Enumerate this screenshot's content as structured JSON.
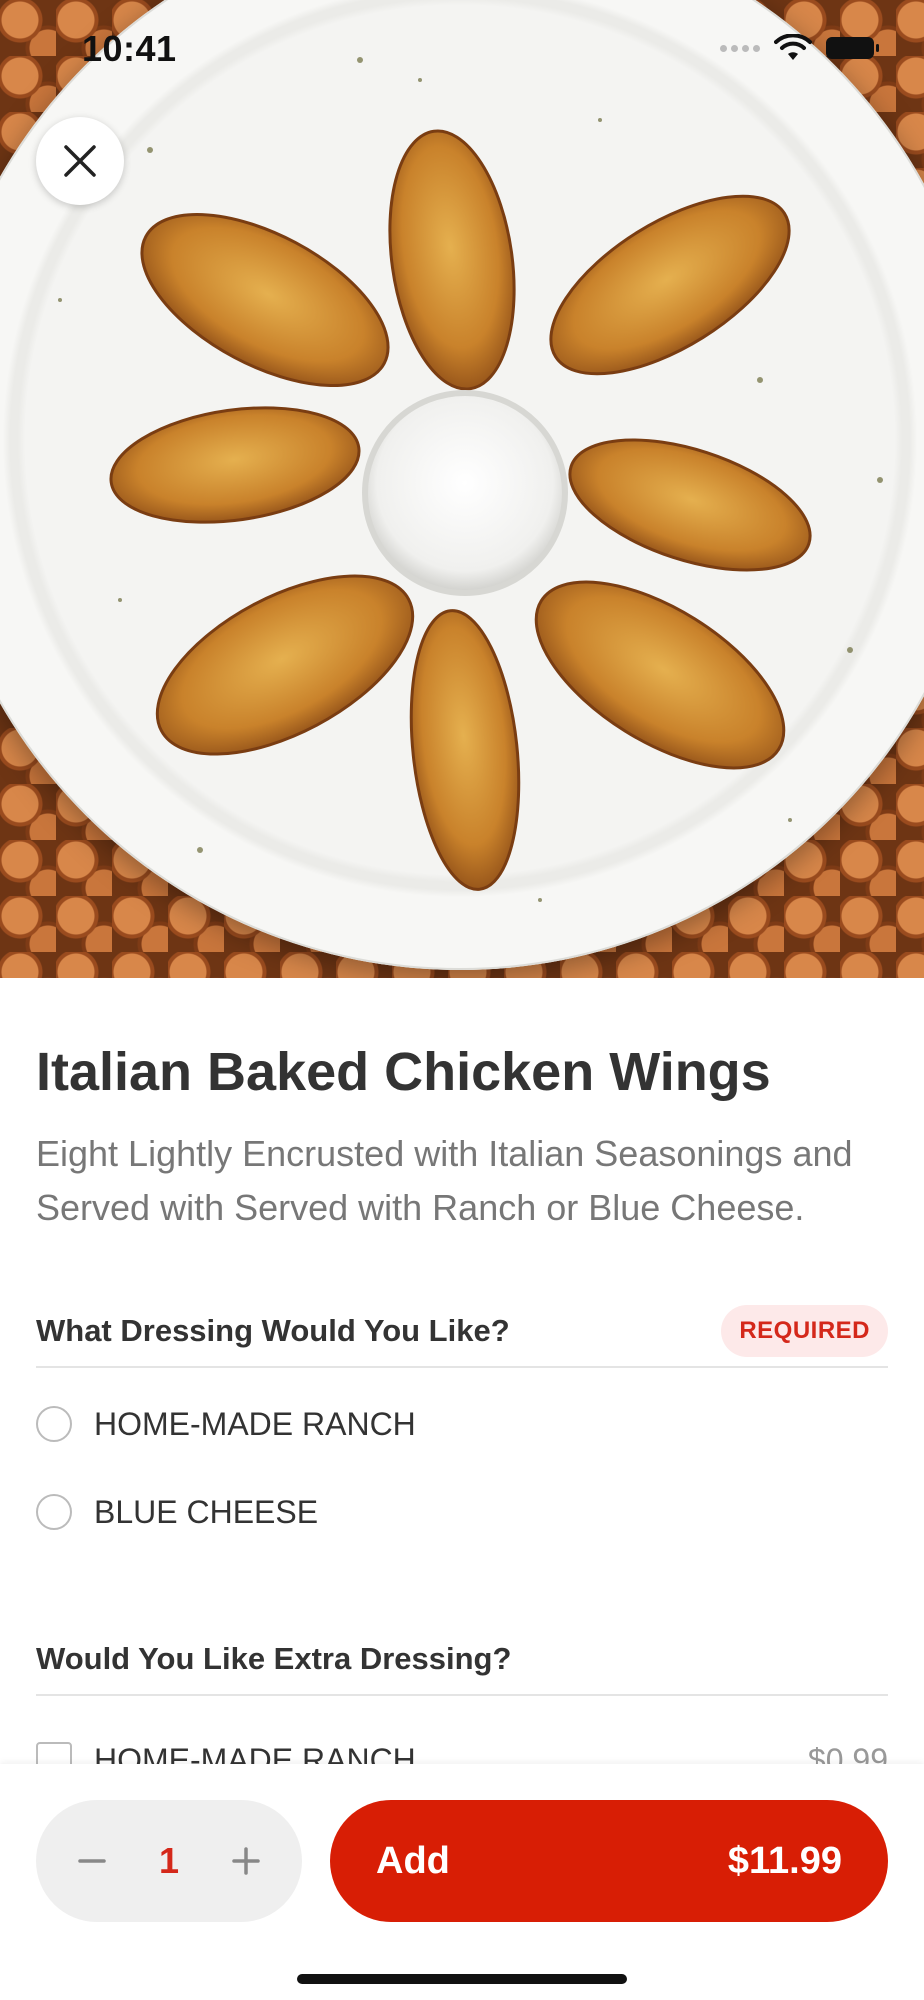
{
  "status_bar": {
    "time": "10:41"
  },
  "item": {
    "title": "Italian Baked Chicken Wings",
    "description": "Eight Lightly Encrusted with Italian Seasonings and Served with Served with Ranch or Blue Cheese."
  },
  "dressing_section": {
    "title": "What Dressing Would You Like?",
    "badge": "REQUIRED",
    "options": [
      {
        "label": "HOME-MADE RANCH"
      },
      {
        "label": "BLUE CHEESE"
      }
    ]
  },
  "extra_section": {
    "title": "Would You Like Extra Dressing?",
    "options": [
      {
        "label": "HOME-MADE RANCH",
        "price": "$0.99"
      }
    ]
  },
  "footer": {
    "quantity": "1",
    "add_label": "Add",
    "price": "$11.99"
  },
  "colors": {
    "accent": "#d81e05",
    "badge_bg": "#fde9e9",
    "badge_text": "#d4281a"
  },
  "icons": [
    "close-icon",
    "minus-icon",
    "plus-icon",
    "wifi-icon",
    "battery-icon",
    "signal-icon"
  ]
}
